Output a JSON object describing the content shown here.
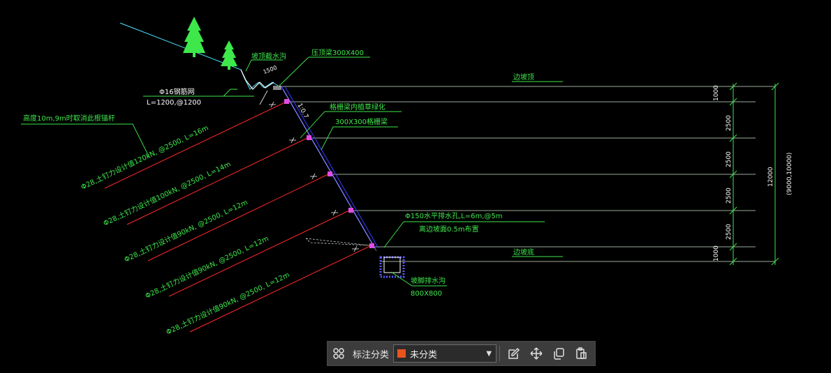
{
  "drawing": {
    "labels": {
      "trench_top": "坡顶截水沟",
      "crown_beam": "压顶梁300X400",
      "dim_1500": "1500",
      "mesh_title": "Φ16钢筋网",
      "mesh_spec": "L=1200,@1200",
      "slope_ratio": "1:0.7",
      "slope_top": "边坡顶",
      "slope_bottom": "边坡底",
      "green_1": "格栅梁内植草绿化",
      "green_2": "300X300格栅梁",
      "note_left": "高度10m,9m时取消此根锚杆",
      "drain_1": "Φ150水平排水孔,L=6m,@5m",
      "drain_2": "离边坡面0.5m布置",
      "ditch_1": "坡脚排水沟",
      "ditch_2": "800X800",
      "anchor_1": "Φ28,土钉力设计值120kN, @2500, L=16m",
      "anchor_2": "Φ28,土钉力设计值100kN, @2500, L=14m",
      "anchor_3": "Φ28,土钉力设计值90kN, @2500, L=12m",
      "anchor_4": "Φ28,土钉力设计值90kN, @2500, L=12m",
      "anchor_5": "Φ28,土钉力设计值90kN, @2500, L=12m"
    },
    "dims": [
      "1000",
      "2500",
      "2500",
      "2500",
      "2500",
      "1000"
    ],
    "total_height": "12000",
    "alt_height": "(9000,10000)"
  },
  "toolbar": {
    "category_label": "标注分类",
    "selected": "未分类",
    "selected_color": "#e8541e",
    "icons": [
      "grid-icon",
      "edit-icon",
      "move-icon",
      "copy-icon",
      "paste-icon"
    ]
  }
}
